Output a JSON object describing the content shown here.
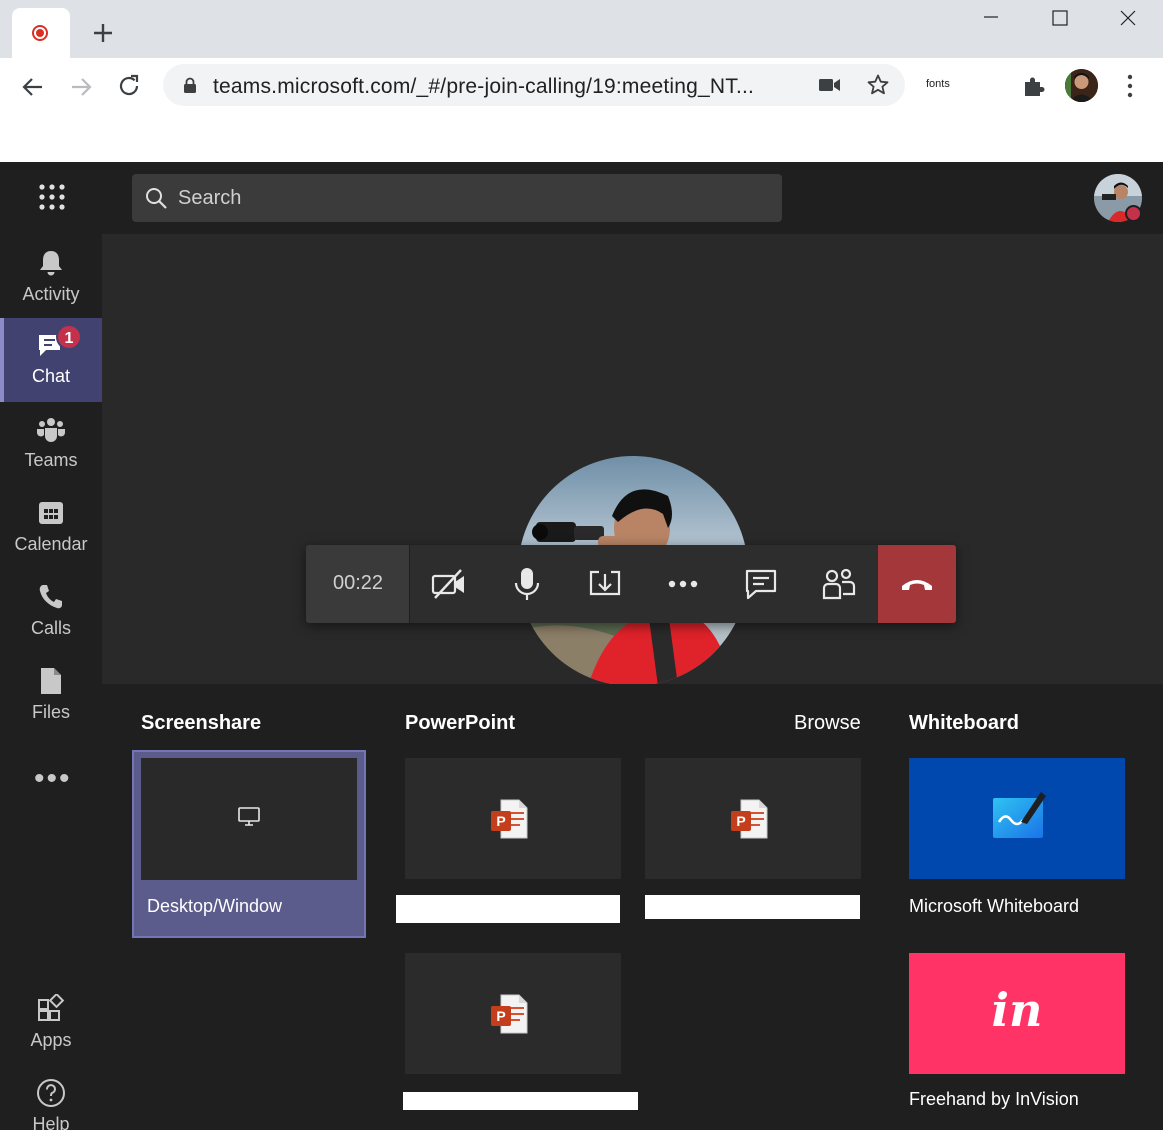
{
  "browser": {
    "url": "teams.microsoft.com/_#/pre-join-calling/19:meeting_NT...",
    "extension_label": "fonts"
  },
  "search": {
    "placeholder": "Search"
  },
  "rail": {
    "items": [
      {
        "label": "Activity",
        "icon": "bell-icon"
      },
      {
        "label": "Chat",
        "icon": "chat-icon",
        "badge": "1",
        "active": true
      },
      {
        "label": "Teams",
        "icon": "teams-icon"
      },
      {
        "label": "Calendar",
        "icon": "calendar-icon"
      },
      {
        "label": "Calls",
        "icon": "phone-icon"
      },
      {
        "label": "Files",
        "icon": "file-icon"
      }
    ],
    "more": "•••",
    "bottom": [
      {
        "label": "Apps",
        "icon": "apps-icon"
      },
      {
        "label": "Help",
        "icon": "help-icon"
      }
    ]
  },
  "call": {
    "timer": "00:22",
    "controls": [
      "camera-off-icon",
      "microphone-icon",
      "share-tray-icon",
      "more-actions-icon",
      "chat-icon",
      "participants-icon",
      "hang-up-icon"
    ]
  },
  "share_tray": {
    "screenshare": {
      "title": "Screenshare",
      "option_label": "Desktop/Window"
    },
    "powerpoint": {
      "title": "PowerPoint",
      "browse_label": "Browse"
    },
    "whiteboard": {
      "title": "Whiteboard",
      "items": [
        {
          "label": "Microsoft Whiteboard"
        },
        {
          "label": "Freehand by InVision",
          "logo_text": "in"
        }
      ]
    }
  },
  "colors": {
    "app_bg": "#1f1f1f",
    "accent": "#5b5b8c",
    "hangup": "#a4373a",
    "whiteboard_tile": "#0048ad",
    "invision_tile": "#ff3366",
    "badge": "#c4314b"
  }
}
